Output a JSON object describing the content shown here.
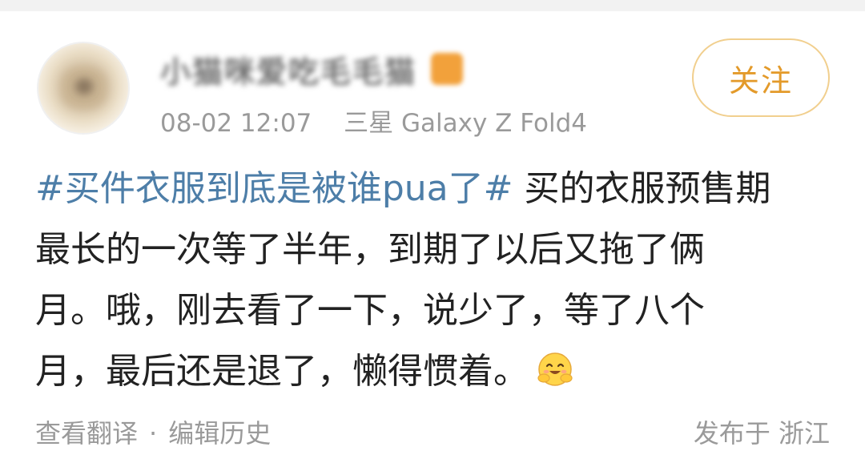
{
  "post": {
    "user": {
      "name": "小猫咪爱吃毛毛猫",
      "avatar": "avatar-image",
      "badge_icon": "vip-badge-icon"
    },
    "meta": {
      "time": "08-02 12:07",
      "device": "三星 Galaxy Z Fold4"
    },
    "follow_label": "关注",
    "hashtag": "#买件衣服到底是被谁pua了#",
    "text_lines": [
      " 买的衣服预售期",
      "最长的一次等了半年，到期了以后又拖了俩",
      "月。哦，刚去看了一下，说少了，等了八个",
      "月，最后还是退了，懒得惯着。"
    ],
    "emoji_icon": "hug-emoji-icon",
    "footer": {
      "translate_label": "查看翻译",
      "separator": "·",
      "edit_history_label": "编辑历史",
      "location": "发布于 浙江"
    }
  },
  "colors": {
    "hashtag": "#4d7ea8",
    "follow_text": "#e39a2a",
    "follow_border": "#f1cf8e",
    "meta_text": "#9a9a9a",
    "body_text": "#222222"
  }
}
